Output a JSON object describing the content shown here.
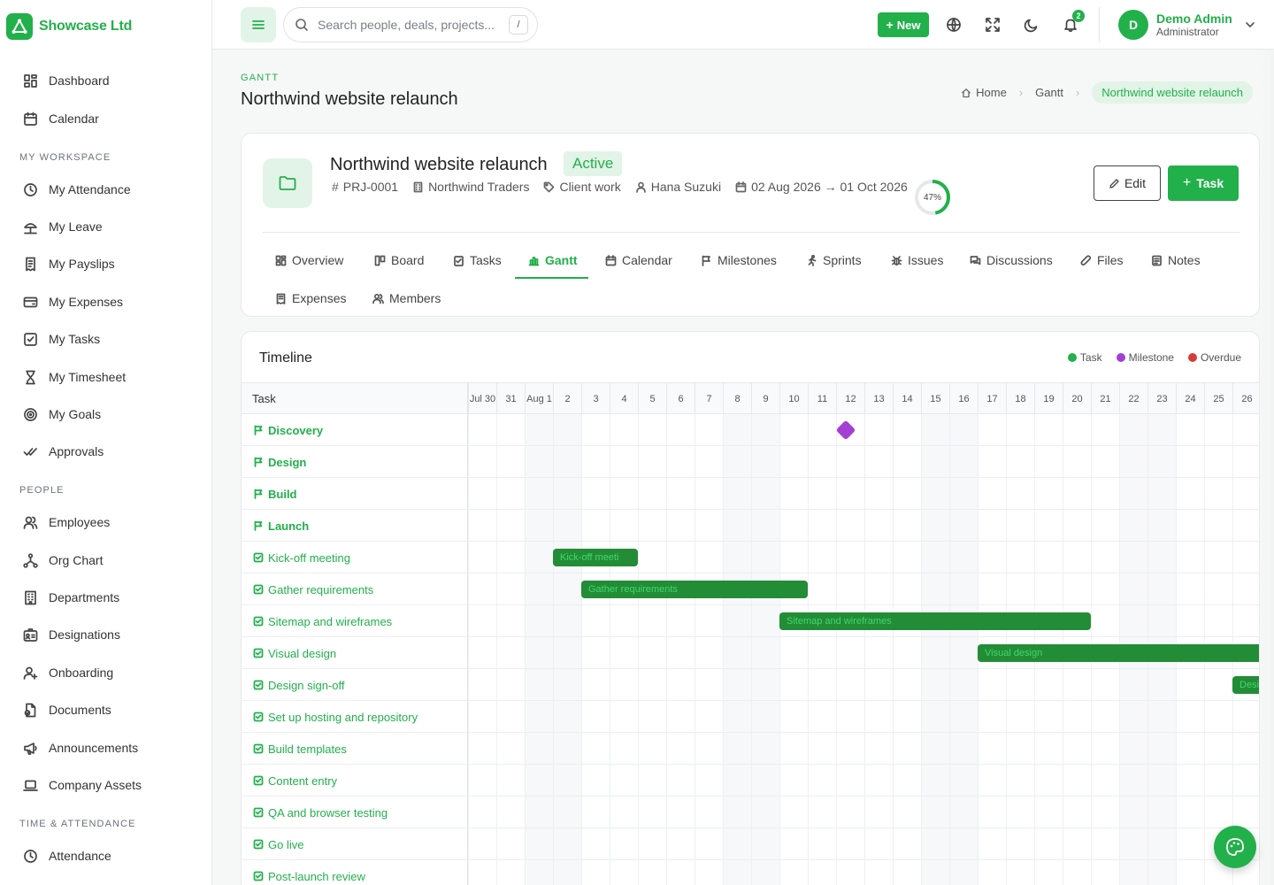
{
  "brand": {
    "name": "Showcase Ltd"
  },
  "sidebar": {
    "top_items": [
      {
        "label": "Dashboard",
        "icon": "dashboard-icon"
      },
      {
        "label": "Calendar",
        "icon": "calendar-icon"
      }
    ],
    "sections": [
      {
        "title": "My Workspace",
        "items": [
          {
            "label": "My Attendance",
            "icon": "clock-icon"
          },
          {
            "label": "My Leave",
            "icon": "umbrella-icon"
          },
          {
            "label": "My Payslips",
            "icon": "receipt-icon"
          },
          {
            "label": "My Expenses",
            "icon": "wallet-icon"
          },
          {
            "label": "My Tasks",
            "icon": "checkbox-icon"
          },
          {
            "label": "My Timesheet",
            "icon": "hourglass-icon"
          },
          {
            "label": "My Goals",
            "icon": "target-icon"
          },
          {
            "label": "Approvals",
            "icon": "double-check-icon"
          }
        ]
      },
      {
        "title": "People",
        "items": [
          {
            "label": "Employees",
            "icon": "users-icon"
          },
          {
            "label": "Org Chart",
            "icon": "org-chart-icon"
          },
          {
            "label": "Departments",
            "icon": "building-icon"
          },
          {
            "label": "Designations",
            "icon": "id-badge-icon"
          },
          {
            "label": "Onboarding",
            "icon": "user-plus-icon"
          },
          {
            "label": "Documents",
            "icon": "documents-icon"
          },
          {
            "label": "Announcements",
            "icon": "megaphone-icon"
          },
          {
            "label": "Company Assets",
            "icon": "laptop-icon"
          }
        ]
      },
      {
        "title": "Time & Attendance",
        "items": [
          {
            "label": "Attendance",
            "icon": "clock-icon"
          }
        ]
      }
    ]
  },
  "topbar": {
    "search_placeholder": "Search people, deals, projects...",
    "search_shortcut": "/",
    "new_label": "New",
    "notification_count": "2",
    "user_initial": "D",
    "user_name": "Demo Admin",
    "user_role": "Administrator"
  },
  "page": {
    "eyebrow": "GANTT",
    "title": "Northwind website relaunch",
    "breadcrumb": [
      "Home",
      "Gantt",
      "Northwind website relaunch"
    ]
  },
  "project": {
    "name": "Northwind website relaunch",
    "status": "Active",
    "code": "PRJ-0001",
    "client": "Northwind Traders",
    "category": "Client work",
    "owner": "Hana Suzuki",
    "dates": "02 Aug 2026 → 01 Oct 2026",
    "progress": 47,
    "progress_label": "47%",
    "edit_label": "Edit",
    "task_label": "Task",
    "tabs": [
      {
        "label": "Overview",
        "icon": "overview-icon"
      },
      {
        "label": "Board",
        "icon": "board-icon"
      },
      {
        "label": "Tasks",
        "icon": "tasks-icon"
      },
      {
        "label": "Gantt",
        "icon": "gantt-icon",
        "active": true
      },
      {
        "label": "Calendar",
        "icon": "calendar-icon"
      },
      {
        "label": "Milestones",
        "icon": "flag-icon"
      },
      {
        "label": "Sprints",
        "icon": "run-icon"
      },
      {
        "label": "Issues",
        "icon": "bug-icon"
      },
      {
        "label": "Discussions",
        "icon": "chat-icon"
      },
      {
        "label": "Files",
        "icon": "paperclip-icon"
      },
      {
        "label": "Notes",
        "icon": "notes-icon"
      },
      {
        "label": "Expenses",
        "icon": "receipt-icon"
      },
      {
        "label": "Members",
        "icon": "users-icon"
      }
    ]
  },
  "timeline": {
    "title": "Timeline",
    "legend": [
      {
        "label": "Task",
        "color": "#22b04b"
      },
      {
        "label": "Milestone",
        "color": "#a43fd4"
      },
      {
        "label": "Overdue",
        "color": "#d93a3a"
      }
    ],
    "task_header": "Task",
    "days": [
      "Jul 30",
      "31",
      "Aug 1",
      "2",
      "3",
      "4",
      "5",
      "6",
      "7",
      "8",
      "9",
      "10",
      "11",
      "12",
      "13",
      "14",
      "15",
      "16",
      "17",
      "18",
      "19",
      "20",
      "21",
      "22",
      "23",
      "24",
      "25",
      "26"
    ],
    "weekend_day_indices": [
      2,
      3,
      9,
      10,
      16,
      17,
      23,
      24
    ],
    "rows": [
      {
        "label": "Discovery",
        "kind": "milestone",
        "milestone_day": "12"
      },
      {
        "label": "Design",
        "kind": "milestone"
      },
      {
        "label": "Build",
        "kind": "milestone"
      },
      {
        "label": "Launch",
        "kind": "milestone"
      },
      {
        "label": "Kick-off meeting",
        "kind": "task",
        "bar_label": "Kick-off meeti",
        "start_day": "2",
        "end_day": "4"
      },
      {
        "label": "Gather requirements",
        "kind": "task",
        "bar_label": "Gather requirements",
        "start_day": "3",
        "end_day": "10"
      },
      {
        "label": "Sitemap and wireframes",
        "kind": "task",
        "bar_label": "Sitemap and wireframes",
        "start_day": "10",
        "end_day": "20"
      },
      {
        "label": "Visual design",
        "kind": "task",
        "bar_label": "Visual design",
        "start_day": "17",
        "end_day": "26+"
      },
      {
        "label": "Design sign-off",
        "kind": "task",
        "bar_label": "Desi",
        "start_day": "26",
        "end_day": "26+"
      },
      {
        "label": "Set up hosting and repository",
        "kind": "task"
      },
      {
        "label": "Build templates",
        "kind": "task"
      },
      {
        "label": "Content entry",
        "kind": "task"
      },
      {
        "label": "QA and browser testing",
        "kind": "task"
      },
      {
        "label": "Go live",
        "kind": "task"
      },
      {
        "label": "Post-launch review",
        "kind": "task"
      }
    ]
  }
}
